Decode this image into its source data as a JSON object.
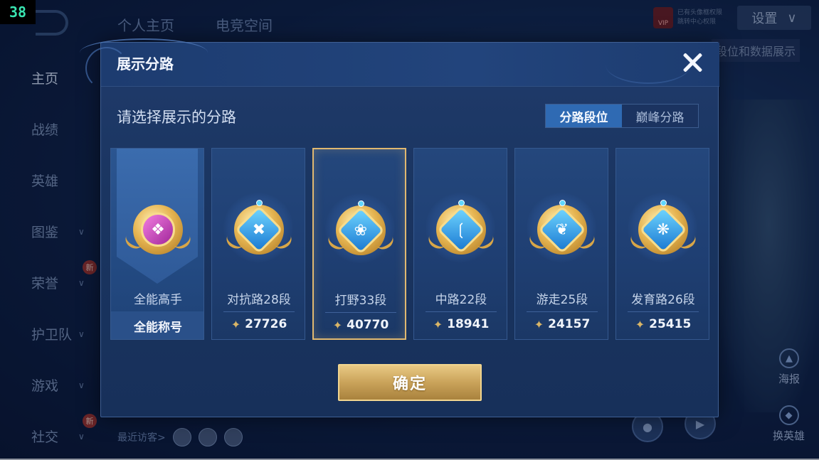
{
  "fps_counter": "38",
  "background": {
    "top_tabs": [
      "个人主页",
      "电竞空间"
    ],
    "sidebar": [
      {
        "label": "主页",
        "active": true
      },
      {
        "label": "战绩"
      },
      {
        "label": "英雄"
      },
      {
        "label": "图鉴",
        "chevron": true
      },
      {
        "label": "荣誉",
        "chevron": true,
        "badge": "新"
      },
      {
        "label": "护卫队",
        "chevron": true
      },
      {
        "label": "游戏",
        "chevron": true
      },
      {
        "label": "社交",
        "chevron": true,
        "badge": "新"
      }
    ],
    "visitors_label": "最近访客>",
    "settings_label": "设置",
    "vip_label": "VIP",
    "vip_text_line1": "已有头像框权限",
    "vip_text_line2": "跳转中心权限",
    "right_chip": "段位和数据展示",
    "poster_label": "海报",
    "swap_hero_label": "换英雄"
  },
  "modal": {
    "title": "展示分路",
    "prompt": "请选择展示的分路",
    "toggle": {
      "left": "分路段位",
      "right": "巅峰分路",
      "selected": "left"
    },
    "cards": [
      {
        "name": "全能高手",
        "stat": "全能称号",
        "icon": "all-round-emblem-icon",
        "selected": false
      },
      {
        "name": "对抗路28段",
        "stat": "27726",
        "icon": "clash-lane-icon",
        "selected": false
      },
      {
        "name": "打野33段",
        "stat": "40770",
        "icon": "jungle-icon",
        "selected": true
      },
      {
        "name": "中路22段",
        "stat": "18941",
        "icon": "mid-lane-icon",
        "selected": false
      },
      {
        "name": "游走25段",
        "stat": "24157",
        "icon": "roam-icon",
        "selected": false
      },
      {
        "name": "发育路26段",
        "stat": "25415",
        "icon": "farm-lane-icon",
        "selected": false
      }
    ],
    "confirm_label": "确定"
  },
  "colors": {
    "accent_gold": "#e0b870",
    "toggle_active": "#2f6ab3",
    "panel": "#1a3561"
  }
}
